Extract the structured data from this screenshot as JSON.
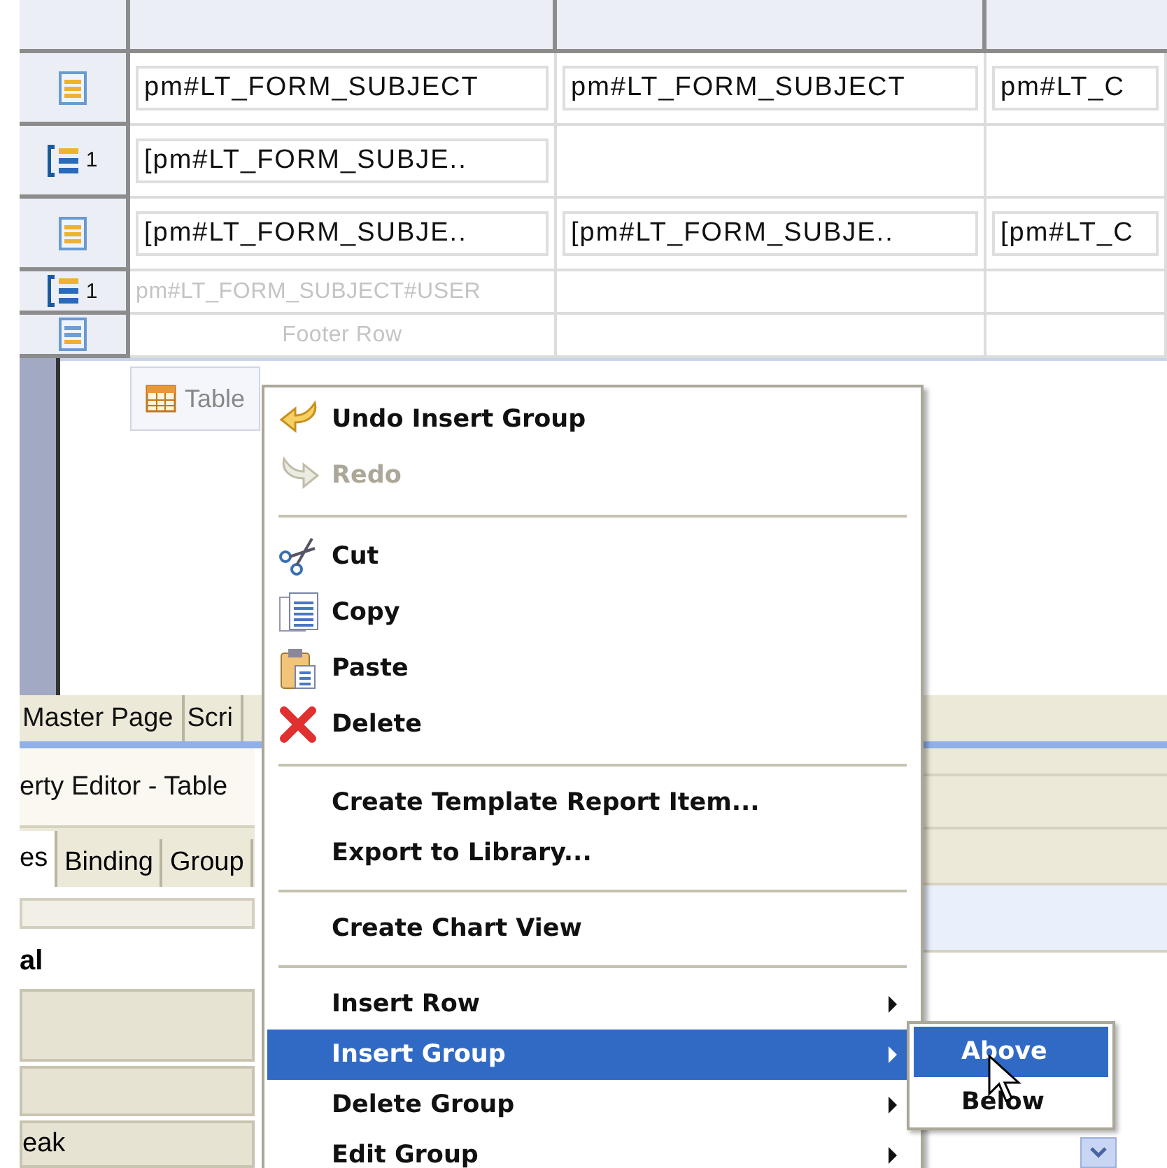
{
  "table": {
    "rows": [
      {
        "gutter": {
          "kind": "row"
        },
        "cells": [
          {
            "kind": "field",
            "text": "pm#LT_FORM_SUBJECT"
          },
          {
            "kind": "field",
            "text": "pm#LT_FORM_SUBJECT"
          },
          {
            "kind": "field",
            "text": "pm#LT_C"
          }
        ]
      },
      {
        "gutter": {
          "kind": "group",
          "group_number": "1"
        },
        "cells": [
          {
            "kind": "field",
            "text": "[pm#LT_FORM_SUBJE.."
          },
          {
            "kind": "empty"
          },
          {
            "kind": "empty"
          }
        ]
      },
      {
        "gutter": {
          "kind": "row"
        },
        "cells": [
          {
            "kind": "field",
            "text": "[pm#LT_FORM_SUBJE.."
          },
          {
            "kind": "field",
            "text": "[pm#LT_FORM_SUBJE.."
          },
          {
            "kind": "field",
            "text": "[pm#LT_C"
          }
        ]
      },
      {
        "gutter": {
          "kind": "group",
          "group_number": "1"
        },
        "cells": [
          {
            "kind": "hint",
            "text": "pm#LT_FORM_SUBJECT#USER"
          },
          {
            "kind": "empty"
          },
          {
            "kind": "empty"
          }
        ]
      },
      {
        "gutter": {
          "kind": "footer"
        },
        "cells": [
          {
            "kind": "centered-hint",
            "text": "Footer Row"
          },
          {
            "kind": "empty"
          },
          {
            "kind": "empty"
          }
        ]
      }
    ]
  },
  "editor_tab": {
    "label": "Table"
  },
  "bottom_tabs": [
    {
      "label": "Master Page",
      "selected": false
    },
    {
      "label": "Scri",
      "selected": false
    }
  ],
  "property_editor": {
    "title": "erty Editor - Table",
    "tabs": [
      {
        "label": "es",
        "selected": true
      },
      {
        "label": "Binding",
        "selected": false
      },
      {
        "label": "Group",
        "selected": false
      }
    ],
    "section": "al",
    "rows": [
      {
        "kind": "blank"
      },
      {
        "kind": "blank"
      },
      {
        "kind": "label",
        "label": "eak"
      }
    ]
  },
  "context_menu": {
    "items": [
      {
        "kind": "undo",
        "label": "Undo Insert Group",
        "disabled": false,
        "selected": false,
        "submenu": false
      },
      {
        "kind": "redo",
        "label": "Redo",
        "disabled": true,
        "selected": false,
        "submenu": false
      },
      {
        "kind": "separator"
      },
      {
        "kind": "cut",
        "label": "Cut",
        "disabled": false,
        "selected": false,
        "submenu": false
      },
      {
        "kind": "copy",
        "label": "Copy",
        "disabled": false,
        "selected": false,
        "submenu": false
      },
      {
        "kind": "paste",
        "label": "Paste",
        "disabled": false,
        "selected": false,
        "submenu": false
      },
      {
        "kind": "delete",
        "label": "Delete",
        "disabled": false,
        "selected": false,
        "submenu": false
      },
      {
        "kind": "separator"
      },
      {
        "kind": "plain",
        "label": "Create Template Report Item...",
        "disabled": false,
        "selected": false,
        "submenu": false
      },
      {
        "kind": "plain",
        "label": "Export to Library...",
        "disabled": false,
        "selected": false,
        "submenu": false
      },
      {
        "kind": "separator"
      },
      {
        "kind": "plain",
        "label": "Create Chart View",
        "disabled": false,
        "selected": false,
        "submenu": false
      },
      {
        "kind": "separator"
      },
      {
        "kind": "plain",
        "label": "Insert Row",
        "disabled": false,
        "selected": false,
        "submenu": true
      },
      {
        "kind": "plain",
        "label": "Insert Group",
        "disabled": false,
        "selected": true,
        "submenu": true
      },
      {
        "kind": "plain",
        "label": "Delete Group",
        "disabled": false,
        "selected": false,
        "submenu": true
      },
      {
        "kind": "plain",
        "label": "Edit Group",
        "disabled": false,
        "selected": false,
        "submenu": true
      }
    ]
  },
  "submenu": {
    "items": [
      {
        "label": "Above",
        "selected": true
      },
      {
        "label": "Below",
        "selected": false
      }
    ]
  }
}
